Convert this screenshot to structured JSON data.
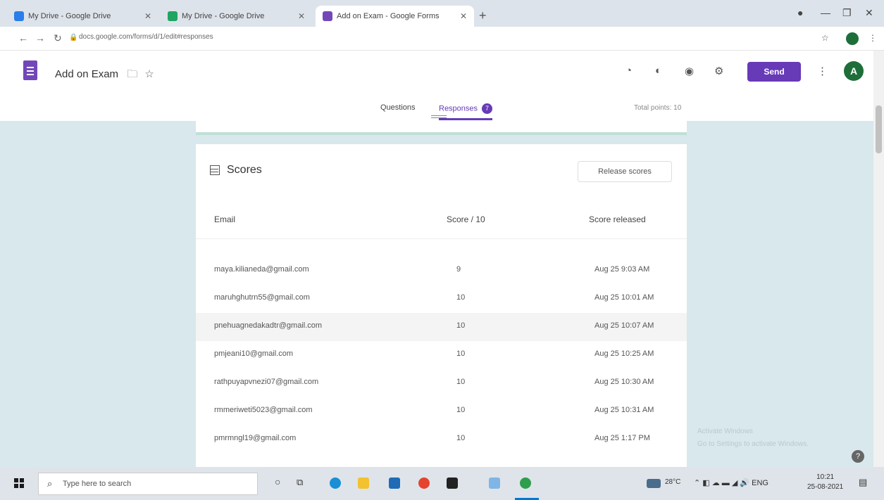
{
  "browser": {
    "tabs": [
      {
        "title": "My Drive - Google Drive",
        "favicon_color": "#2b7de9"
      },
      {
        "title": "My Drive - Google Drive",
        "favicon_color": "#1fa463"
      },
      {
        "title": "Add on Exam - Google Forms",
        "favicon_color": "#7248b9"
      }
    ],
    "url": "docs.google.com/forms/d/1/edit#responses"
  },
  "form": {
    "title": "Add on Exam",
    "send_label": "Send",
    "avatar_letter": "A",
    "tabs": {
      "questions": "Questions",
      "responses": "Responses",
      "responses_badge": "7"
    },
    "total_points": "Total points: 10"
  },
  "scores": {
    "heading": "Scores",
    "release_button": "Release scores",
    "columns": {
      "email": "Email",
      "score": "Score / 10",
      "released": "Score released"
    },
    "rows": [
      {
        "email": "maya.kilianeda@gmail.com",
        "score": "9",
        "released": "Aug 25 9:03 AM"
      },
      {
        "email": "maruhghutrn55@gmail.com",
        "score": "10",
        "released": "Aug 25 10:01 AM"
      },
      {
        "email": "pnehuagnedakadtr@gmail.com",
        "score": "10",
        "released": "Aug 25 10:07 AM"
      },
      {
        "email": "pmjeani10@gmail.com",
        "score": "10",
        "released": "Aug 25 10:25 AM"
      },
      {
        "email": "rathpuyapvnezi07@gmail.com",
        "score": "10",
        "released": "Aug 25 10:30 AM"
      },
      {
        "email": "rmmeriweti5023@gmail.com",
        "score": "10",
        "released": "Aug 25 10:31 AM"
      },
      {
        "email": "pmrmngl19@gmail.com",
        "score": "10",
        "released": "Aug 25 1:17 PM"
      }
    ]
  },
  "watermark": [
    "Activate Windows",
    "Go to Settings to activate Windows."
  ],
  "taskbar": {
    "search_placeholder": "Type here to search",
    "weather": "28°C",
    "clock_time": "10:21",
    "clock_date": "25-08-2021"
  },
  "colors": {
    "accent": "#673ab7",
    "mint_bg": "#d8e8ec",
    "profile": "#1e6e3a"
  }
}
